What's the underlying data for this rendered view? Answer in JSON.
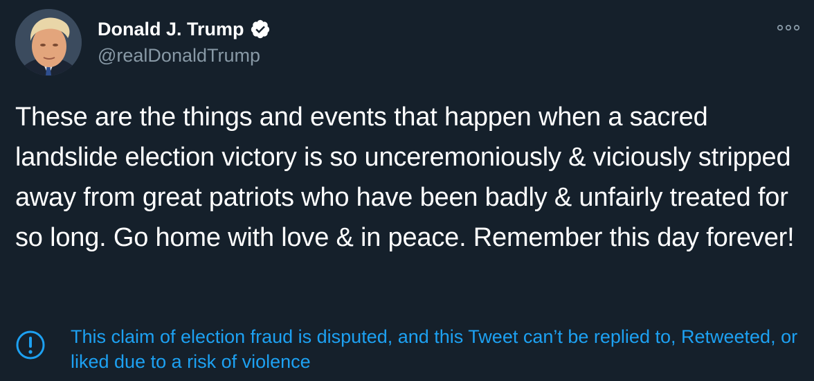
{
  "tweet": {
    "author": {
      "display_name": "Donald J. Trump",
      "handle": "@realDonaldTrump",
      "verified": true,
      "avatar_icon": "profile-photo"
    },
    "more_icon": "more-options-icon",
    "text": "These are the things and events that happen when a sacred landslide election victory is so unceremoniously & viciously stripped away from great patriots who have been badly & unfairly treated for so long. Go home with love & in peace. Remember this day forever!",
    "notice": {
      "icon": "exclamation-circle-icon",
      "text": "This claim of election fraud is disputed, and this Tweet can’t be replied to, Retweeted, or liked due to a risk of violence"
    }
  },
  "colors": {
    "background": "#15202b",
    "primary_text": "#ffffff",
    "secondary_text": "#8899a6",
    "accent": "#1da1f2"
  }
}
